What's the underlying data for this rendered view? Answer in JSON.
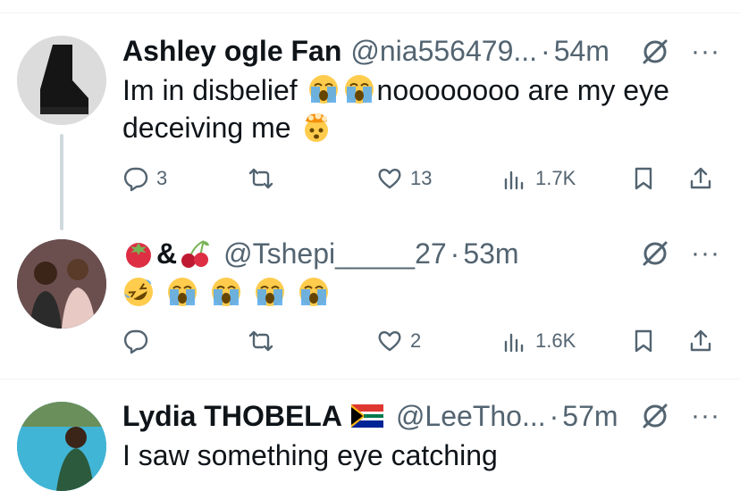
{
  "tweets": [
    {
      "name": "Ashley ogle Fan",
      "handle": "@nia556479...",
      "separator": "·",
      "time": "54m",
      "text_prefix": "Im in disbelief",
      "text_middle": "noooooooo are my eye",
      "text_line2": "deceiving me",
      "emojis": [
        "loudly-crying-face",
        "loudly-crying-face",
        "exploding-head"
      ],
      "replies": "3",
      "retweets": "",
      "likes": "13",
      "views": "1.7K"
    },
    {
      "name_emojis": [
        "tomato",
        "cherries"
      ],
      "name_text": "&",
      "handle": "@Tshepi_____27",
      "separator": "·",
      "time": "53m",
      "emojis": [
        "rolling-on-floor-laughing",
        "loudly-crying-face",
        "loudly-crying-face",
        "loudly-crying-face",
        "loudly-crying-face"
      ],
      "replies": "",
      "retweets": "",
      "likes": "2",
      "views": "1.6K"
    },
    {
      "name": "Lydia THOBELA",
      "name_flag": "south-africa-flag",
      "handle": "@LeeTho...",
      "separator": "·",
      "time": "57m",
      "text": "I saw something eye catching"
    }
  ],
  "colors": {
    "text": "#0f1419",
    "secondary": "#536471",
    "divider": "#eff3f4",
    "thread": "#cfd9de"
  }
}
